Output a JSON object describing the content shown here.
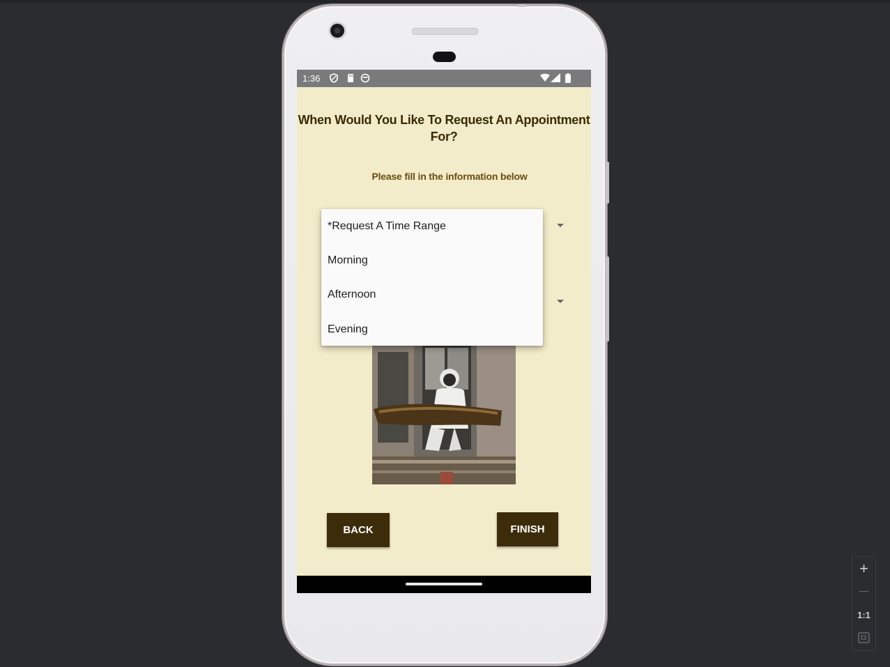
{
  "status_bar": {
    "time": "1:36"
  },
  "screen": {
    "heading": "When Would You Like To Request An Appointment For?",
    "subheading": "Please fill in the information below",
    "dropdown": {
      "options": [
        "*Request A Time Range",
        "Morning",
        "Afternoon",
        "Evening"
      ]
    },
    "photo": {
      "alt": "Beekeeper in protective suit holding honeycomb"
    },
    "back_button": "BACK",
    "finish_button": "FINISH"
  },
  "zoom_controls": {
    "plus": "+",
    "minus": "—",
    "one_to_one": "1:1"
  },
  "colors": {
    "screen_bg": "#f2ecca",
    "heading": "#3b2a06",
    "subheading": "#6b4c12",
    "button_bg": "#3d2c0a"
  }
}
